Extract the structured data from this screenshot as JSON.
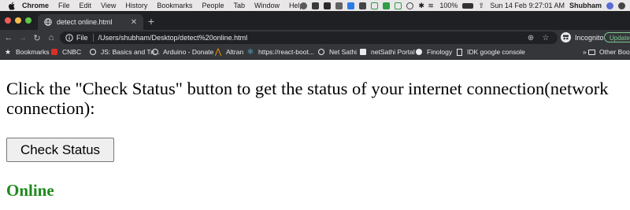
{
  "menubar": {
    "items": [
      "Chrome",
      "File",
      "Edit",
      "View",
      "History",
      "Bookmarks",
      "People",
      "Tab",
      "Window",
      "Help"
    ],
    "battery": "100%",
    "datetime": "Sun 14 Feb  9:27:01 AM",
    "user": "Shubham"
  },
  "tab": {
    "title": "detect online.html",
    "favicon": "globe-icon"
  },
  "toolbar": {
    "scheme": "File",
    "url": "/Users/shubham/Desktop/detect%20online.html",
    "profile": "Incognito",
    "update_label": "Update"
  },
  "bookmarks": {
    "items": [
      "Bookmarks",
      "CNBC",
      "JS: Basics and Tri...",
      "Arduino - Donate",
      "Altran",
      "https://react-boot...",
      "Net Sathi",
      "netSathi Portal",
      "Finology",
      "IDK google console"
    ],
    "overflow": "»",
    "other": "Other Bookm"
  },
  "page": {
    "prompt": "Click the \"Check Status\" button to get the status of your internet connection(network connection):",
    "button_label": "Check Status",
    "status_text": "Online",
    "status_color": "#1e8a1e"
  }
}
